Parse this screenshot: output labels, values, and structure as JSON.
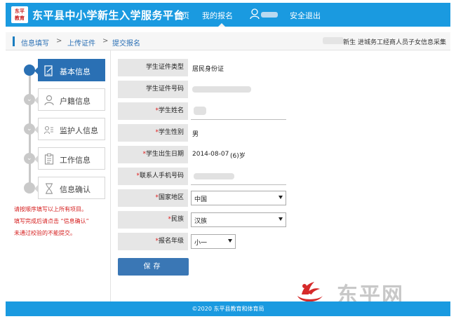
{
  "header": {
    "logo_text": "东平\n教育",
    "title": "东平县中小学新生入学服务平台",
    "nav": [
      {
        "label": "首页"
      },
      {
        "label": "我的报名"
      },
      {
        "label": "安全退出"
      }
    ],
    "colors": {
      "bar": "#1a9ae0",
      "accent": "#2a70b4",
      "required": "#e02020"
    }
  },
  "breadcrumb": {
    "items": [
      "信息填写",
      "上传证件",
      "提交报名"
    ],
    "separator": ">",
    "right_text": "新生 进城务工经商人员子女信息采集"
  },
  "steps": [
    {
      "label": "基本信息",
      "icon": "edit-doc-icon",
      "active": true
    },
    {
      "label": "户籍信息",
      "icon": "person-icon",
      "active": false
    },
    {
      "label": "监护人信息",
      "icon": "id-card-icon",
      "active": false
    },
    {
      "label": "工作信息",
      "icon": "clipboard-icon",
      "active": false
    },
    {
      "label": "信息确认",
      "icon": "hourglass-icon",
      "active": false
    }
  ],
  "notes": [
    "请按顺序填写以上所有项目。",
    "填写完成后请点击 “信息确认”",
    "未通过校验的不能提交。"
  ],
  "form": {
    "id_type": {
      "label": "学生证件类型",
      "value": "居民身份证"
    },
    "id_number": {
      "label": "学生证件号码"
    },
    "name": {
      "label": "学生姓名",
      "req": "*"
    },
    "gender": {
      "label": "学生性别",
      "value": "男",
      "req": "*"
    },
    "birth_date": {
      "label": "学生出生日期",
      "value": "2014-08-07",
      "age": "(6)岁",
      "req": "*"
    },
    "phone": {
      "label": "联系人手机号码",
      "req": "*"
    },
    "region": {
      "label": "国家地区",
      "value": "中国",
      "req": "*"
    },
    "ethnicity": {
      "label": "民族",
      "value": "汉族",
      "req": "*"
    },
    "grade": {
      "label": "报名年级",
      "value": "小一",
      "req": "*"
    }
  },
  "save_label": "保存",
  "watermark": "东平网",
  "footer": "©2020  东平县教育和体育局"
}
